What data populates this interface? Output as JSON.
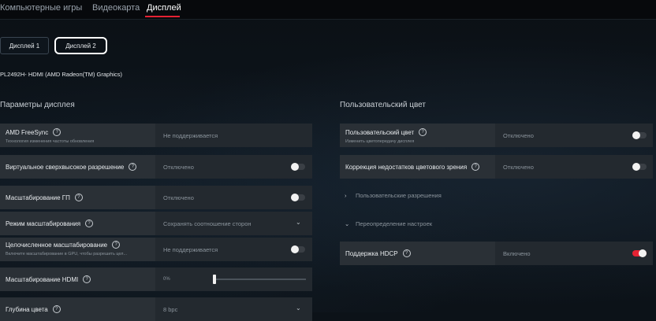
{
  "topnav": {
    "tabs": [
      {
        "label": "Компьютерные игры"
      },
      {
        "label": "Видеокарта"
      },
      {
        "label": "Дисплей"
      }
    ]
  },
  "display_selector": {
    "display1": "Дисплей 1",
    "display2": "Дисплей 2"
  },
  "monitor_name": "PL2492H- HDMI (AMD Radeon(TM) Graphics)",
  "display_params": {
    "title": "Параметры дисплея",
    "freesync": {
      "name": "AMD FreeSync",
      "sub": "Технология изменения частоты обновления",
      "value": "Не поддерживается"
    },
    "vsr": {
      "name": "Виртуальное сверхвысокое разрешение",
      "value": "Отключено"
    },
    "gpu_scaling": {
      "name": "Масштабирование ГП"
    },
    "scaling_mode": {
      "name": "Режим масштабирования",
      "value": "Сохранять соотношение сторон"
    },
    "integer_scaling": {
      "name": "Целочисленное масштабирование",
      "sub": "Включите масштабирование в GPU, чтобы разрешить цел...",
      "value": "Не поддерживается"
    },
    "hdmi_scaling": {
      "name": "Масштабирование HDMI",
      "value": "0%"
    },
    "color_depth": {
      "name": "Глубина цвета",
      "value": "8 bpc"
    }
  },
  "custom_color": {
    "title": "Пользовательский цвет",
    "custom": {
      "name": "Пользовательский цвет",
      "sub": "Изменить цветопередачу дисплея",
      "value": "Отключено"
    },
    "color_deficiency": {
      "name": "Коррекция недостатков цветового зрения",
      "value": "Отключено"
    },
    "custom_resolutions": "Пользовательские разрешения",
    "override": "Переопределение настроек",
    "hdcp": {
      "name": "Поддержка HDCP",
      "value": "Включено"
    }
  },
  "states": {
    "vsr_on": false,
    "gpu_scaling_on": false,
    "integer_scaling_on": false,
    "custom_color_on": false,
    "color_deficiency_on": false,
    "hdcp_on": true,
    "hdmi_scaling_percent": 0
  },
  "colors": {
    "accent": "#e52233"
  }
}
